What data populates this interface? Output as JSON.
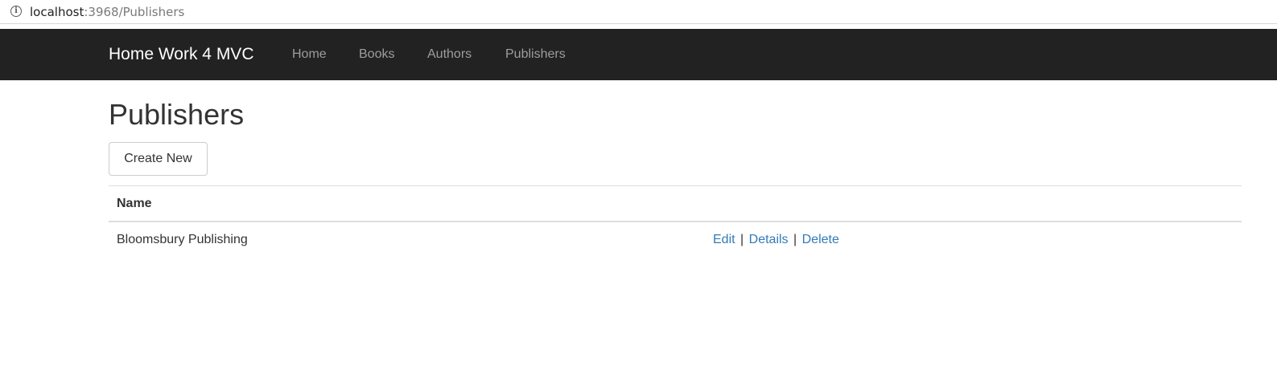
{
  "browser": {
    "url_host": "localhost",
    "url_rest": ":3968/Publishers",
    "info_icon": "info-circle-icon"
  },
  "navbar": {
    "brand": "Home Work 4 MVC",
    "items": [
      {
        "label": "Home"
      },
      {
        "label": "Books"
      },
      {
        "label": "Authors"
      },
      {
        "label": "Publishers"
      }
    ],
    "colors": {
      "background": "#222222",
      "brand": "#ffffff",
      "link": "#9d9d9d"
    }
  },
  "page": {
    "title": "Publishers",
    "create_button": "Create New"
  },
  "table": {
    "columns": [
      "Name",
      ""
    ],
    "rows": [
      {
        "name": "Bloomsbury Publishing",
        "actions": {
          "edit": "Edit",
          "details": "Details",
          "delete": "Delete",
          "separator": "|"
        }
      }
    ],
    "link_color": "#337ab7"
  }
}
